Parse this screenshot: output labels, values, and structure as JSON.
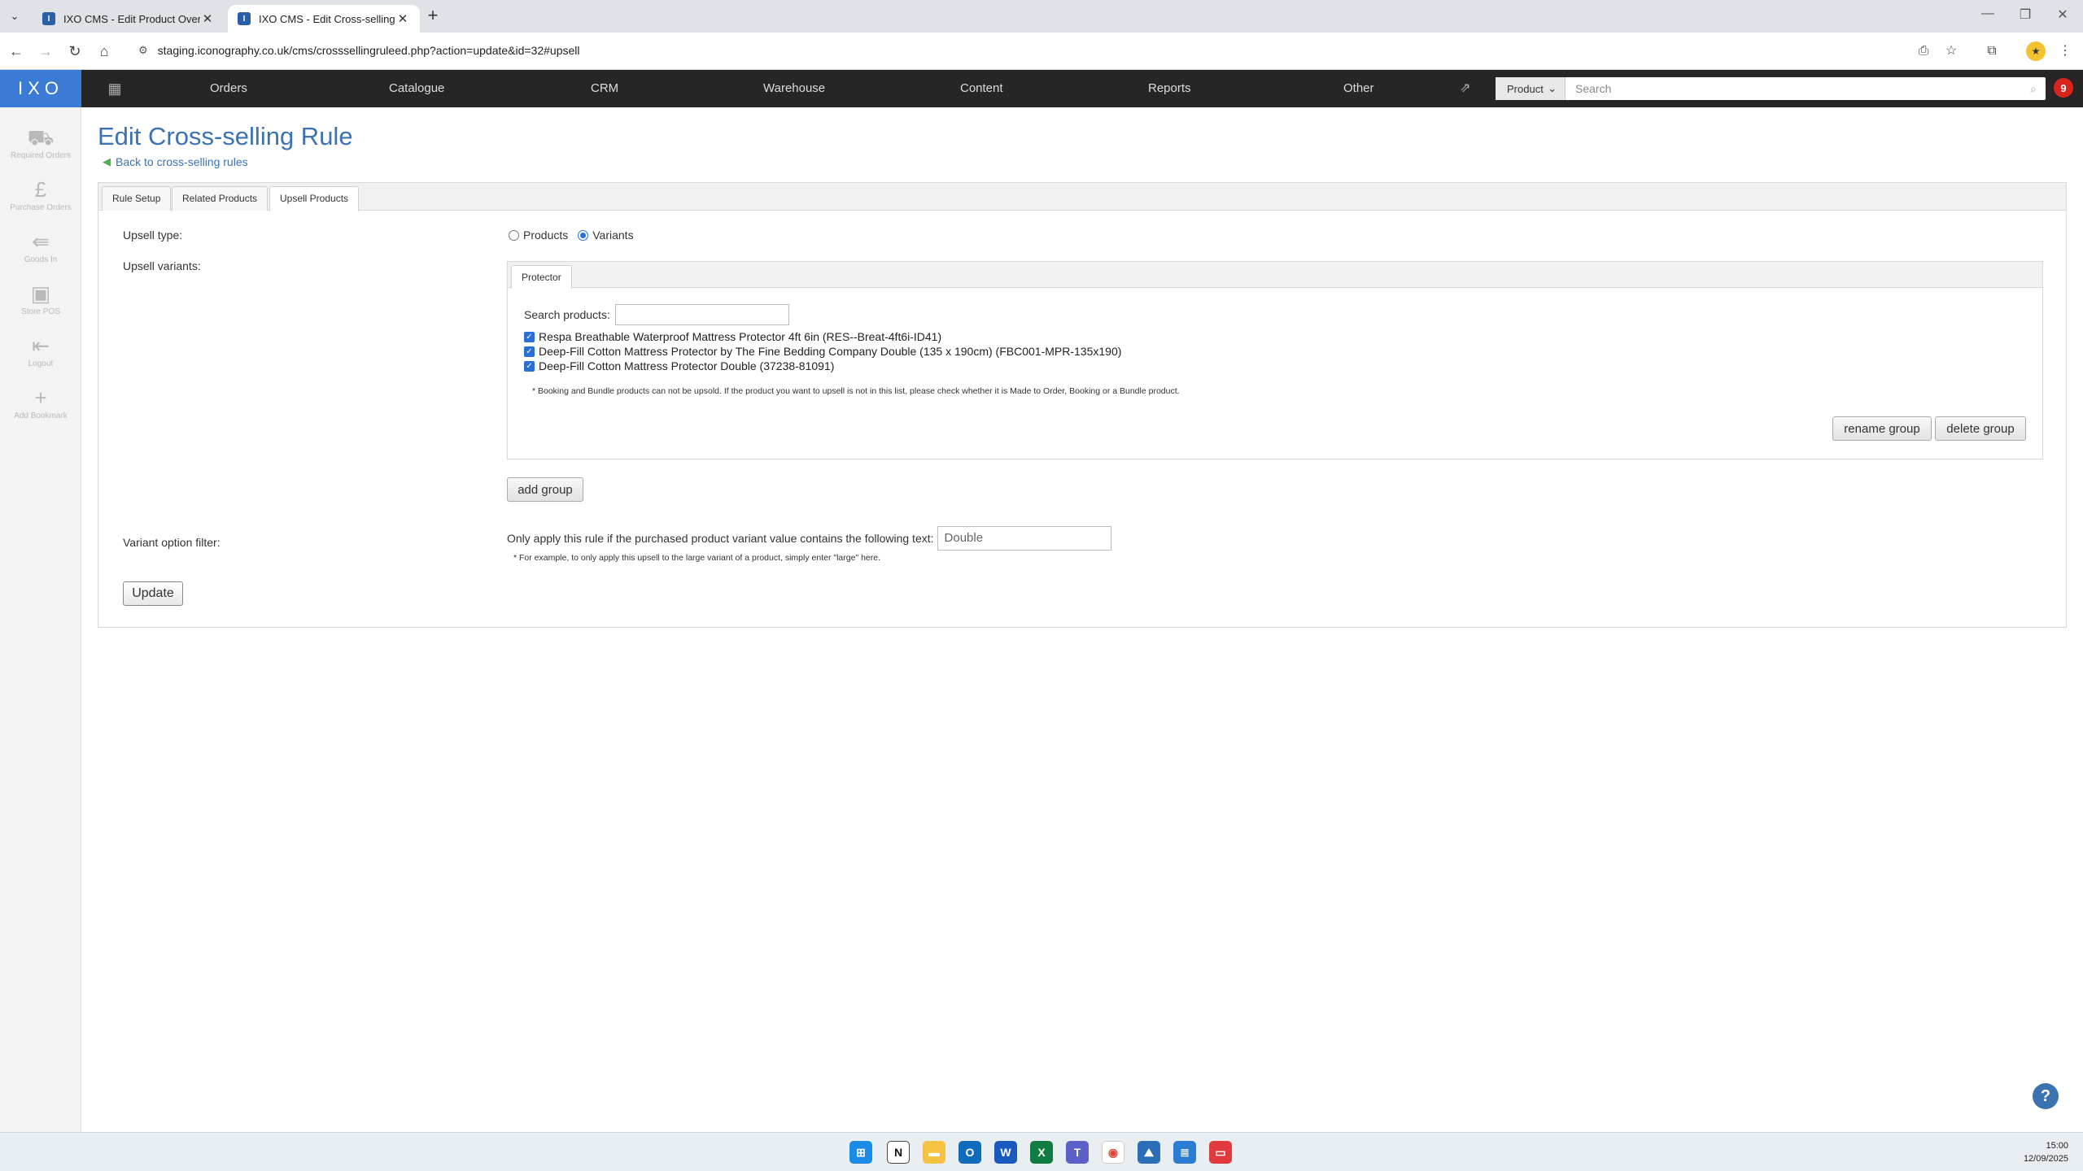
{
  "browser": {
    "tabs": [
      {
        "title": "IXO CMS - Edit Product Overlay",
        "favicon": "I"
      },
      {
        "title": "IXO CMS - Edit Cross-selling Ru",
        "favicon": "I"
      }
    ],
    "url": "staging.iconography.co.uk/cms/crosssellingruleed.php?action=update&id=32#upsell"
  },
  "topnav": {
    "logo": "IXO",
    "items": [
      "Orders",
      "Catalogue",
      "CRM",
      "Warehouse",
      "Content",
      "Reports",
      "Other"
    ],
    "search_scope": "Product",
    "search_placeholder": "Search",
    "notification_count": "9"
  },
  "sidebar": {
    "items": [
      {
        "label": "Required Orders",
        "icon": "boxes-icon"
      },
      {
        "label": "Purchase Orders",
        "icon": "pound-doc-icon"
      },
      {
        "label": "Goods In",
        "icon": "goods-in-icon"
      },
      {
        "label": "Store POS",
        "icon": "pos-icon"
      },
      {
        "label": "Logout",
        "icon": "logout-icon"
      },
      {
        "label": "Add Bookmark",
        "icon": "plus-icon"
      }
    ]
  },
  "page": {
    "title": "Edit Cross-selling Rule",
    "back_link": "Back to cross-selling rules",
    "tabs": [
      "Rule Setup",
      "Related Products",
      "Upsell Products"
    ],
    "active_tab": "Upsell Products"
  },
  "form": {
    "upsell_type_label": "Upsell type:",
    "upsell_type_options": [
      "Products",
      "Variants"
    ],
    "upsell_type_selected": "Variants",
    "upsell_variants_label": "Upsell variants:",
    "group": {
      "name": "Protector",
      "search_label": "Search products:",
      "items": [
        "Respa Breathable Waterproof Mattress Protector 4ft 6in (RES--Breat-4ft6i-ID41)",
        "Deep-Fill Cotton Mattress Protector by The Fine Bedding Company Double (135 x 190cm) (FBC001-MPR-135x190)",
        "Deep-Fill Cotton Mattress Protector Double (37238-81091)"
      ],
      "note": "* Booking and Bundle products can not be upsold. If the product you want to upsell is not in this list, please check whether it is Made to Order, Booking or a Bundle product.",
      "rename_button": "rename group",
      "delete_button": "delete group"
    },
    "add_group_button": "add group",
    "variant_filter_label": "Variant option filter:",
    "variant_filter_text": "Only apply this rule if the purchased product variant value contains the following text:",
    "variant_filter_value": "Double",
    "variant_filter_note": "* For example, to only apply this upsell to the large variant of a product, simply enter \"large\" here.",
    "update_button": "Update"
  },
  "taskbar": {
    "time": "15:00",
    "date": "12/09/2025"
  },
  "colors": {
    "accent": "#3b72b0",
    "logo_bg": "#3a7bd5",
    "nav_bg": "#262626",
    "badge": "#d9241c"
  }
}
